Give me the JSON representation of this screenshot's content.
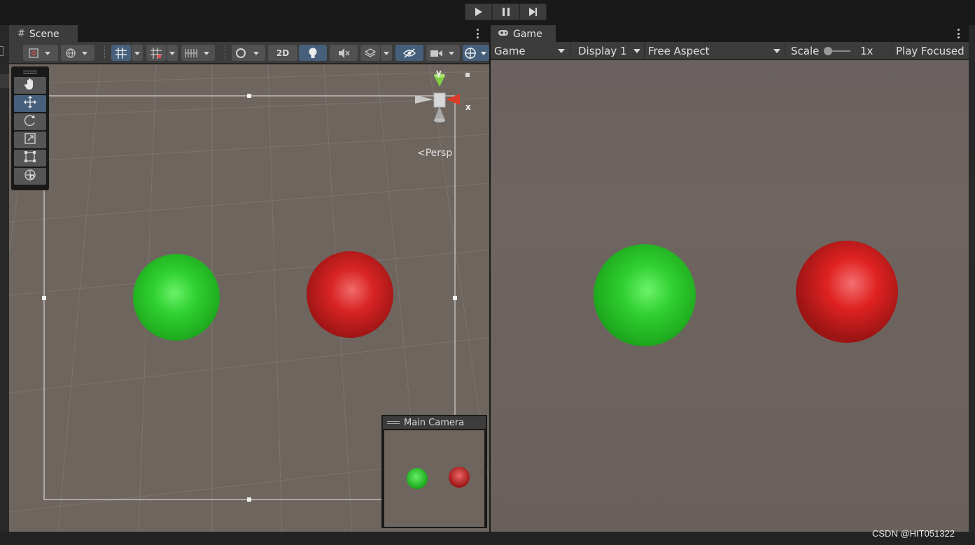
{
  "playbar": {
    "play_icon": "play-icon",
    "pause_icon": "pause-icon",
    "step_icon": "step-forward-icon"
  },
  "scene": {
    "tab_label": "Scene",
    "tab_icon": "grid-hash-icon",
    "toolbar": {
      "btn_2d_label": "2D"
    },
    "gizmo": {
      "axis_y": "y",
      "axis_x": "x",
      "projection_label": "Persp"
    },
    "camera_preview": {
      "title": "Main Camera"
    },
    "tools": [
      "hand-tool-icon",
      "move-tool-icon",
      "rotate-tool-icon",
      "scale-tool-icon",
      "rect-tool-icon",
      "transform-tool-icon"
    ]
  },
  "game": {
    "tab_label": "Game",
    "tab_icon": "gamepad-icon",
    "toolbar": {
      "view_select": "Game",
      "display_select": "Display 1",
      "aspect_select": "Free Aspect",
      "scale_label": "Scale",
      "scale_value": "1x",
      "play_mode": "Play Focused"
    }
  },
  "watermark": "CSDN @HIT051322",
  "colors": {
    "green_sphere": "#22cc22",
    "red_sphere": "#dd2222",
    "accent_active": "#46607c"
  }
}
